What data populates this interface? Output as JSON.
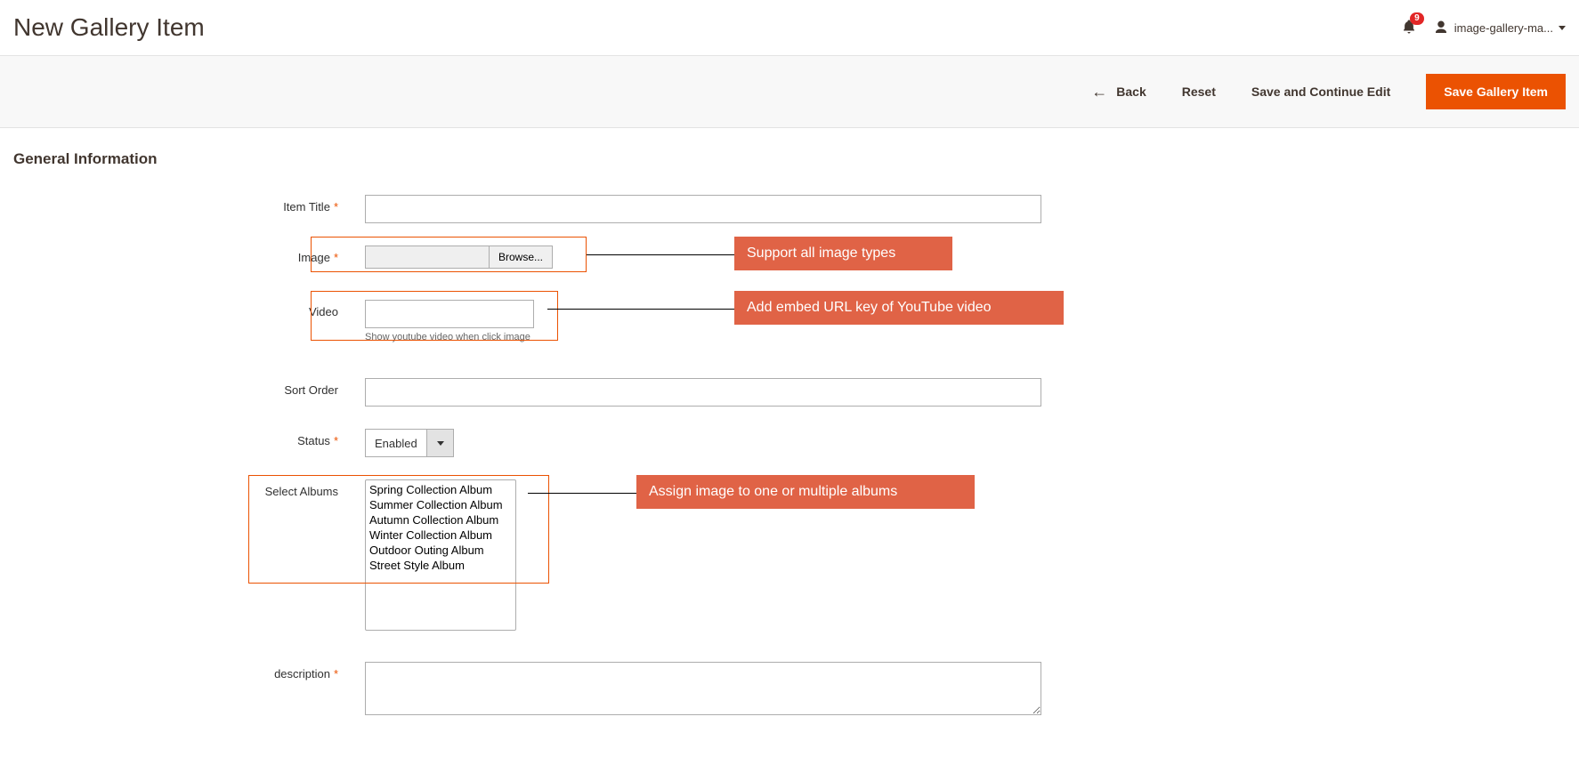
{
  "header": {
    "title": "New Gallery Item",
    "notifications": {
      "count": "9"
    },
    "user": {
      "name": "image-gallery-ma..."
    }
  },
  "actions": {
    "back": "Back",
    "reset": "Reset",
    "save_continue": "Save and Continue Edit",
    "save": "Save Gallery Item"
  },
  "section": {
    "title": "General Information"
  },
  "form": {
    "item_title": {
      "label": "Item Title",
      "value": ""
    },
    "image": {
      "label": "Image",
      "browse": "Browse...",
      "callout": "Support all image types"
    },
    "video": {
      "label": "Video",
      "value": "",
      "hint": "Show youtube video when click image",
      "callout": "Add embed URL key of YouTube video"
    },
    "sort_order": {
      "label": "Sort Order",
      "value": ""
    },
    "status": {
      "label": "Status",
      "value": "Enabled"
    },
    "albums": {
      "label": "Select Albums",
      "options": [
        "Spring Collection Album",
        "Summer Collection Album",
        "Autumn Collection Album",
        "Winter Collection Album",
        "Outdoor Outing Album",
        "Street Style Album"
      ],
      "callout": "Assign image to one or multiple albums"
    },
    "description": {
      "label": "description",
      "value": ""
    }
  }
}
